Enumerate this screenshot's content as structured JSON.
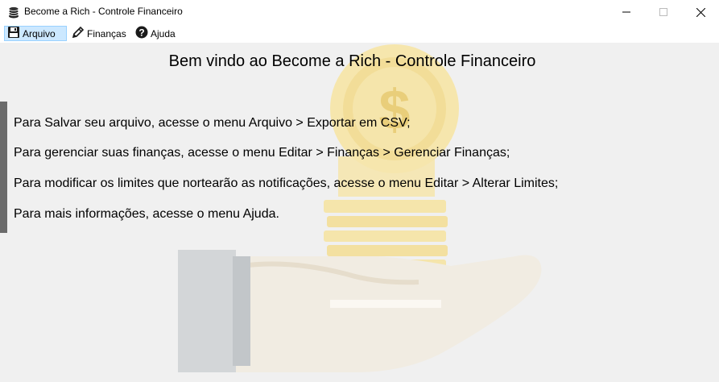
{
  "window": {
    "title": "Become a Rich - Controle Financeiro",
    "icon": "coins-icon",
    "controls": [
      "minimize-icon",
      "maximize-icon",
      "close-icon"
    ]
  },
  "menu": {
    "items": [
      {
        "label": "Arquivo",
        "icon": "floppy-disk-icon",
        "active": true
      },
      {
        "label": "Finanças",
        "icon": "pencil-icon",
        "active": false
      },
      {
        "label": "Ajuda",
        "icon": "help-icon",
        "active": false
      }
    ]
  },
  "main": {
    "welcome": "Bem vindo ao Become a Rich - Controle Financeiro",
    "instructions": [
      "Para Salvar seu arquivo, acesse o menu Arquivo > Exportar em CSV;",
      "Para gerenciar suas finanças, acesse o menu Editar > Finanças > Gerenciar Finanças;",
      "Para modificar os limites que nortearão as notificações, acesse o menu Editar > Alterar Limites;",
      "Para mais informações, acesse o menu Ajuda."
    ],
    "background_image": "hand-holding-coins-icon"
  },
  "colors": {
    "menu_active_bg": "#cce8ff",
    "menu_active_border": "#99d1ff",
    "coin_gold": "#f7e6a6",
    "sleeve_gray": "#d0d3d5"
  }
}
